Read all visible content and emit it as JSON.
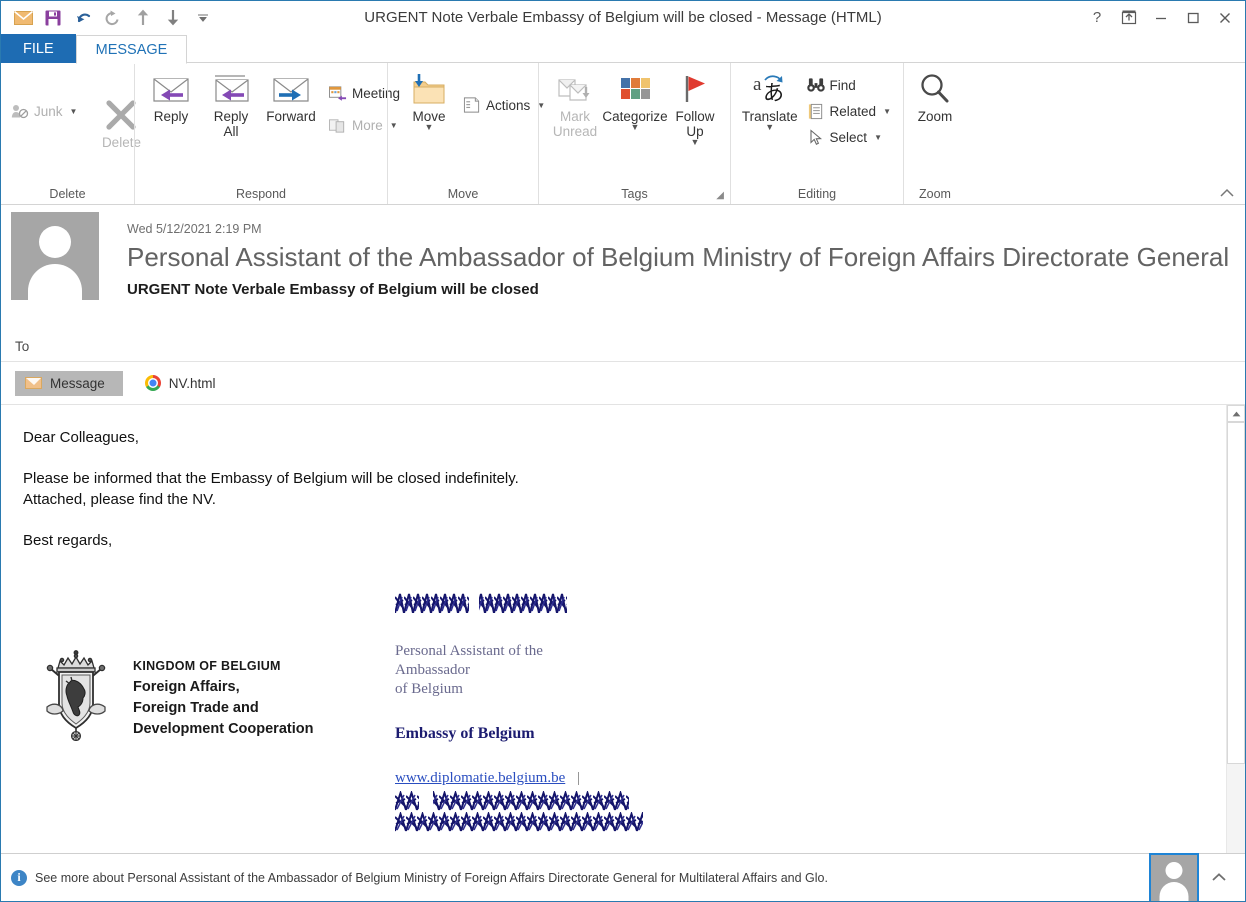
{
  "titlebar": {
    "title": "URGENT Note Verbale Embassy of Belgium will be closed - Message (HTML)",
    "qat": [
      {
        "name": "envelope-icon",
        "label": "Message"
      },
      {
        "name": "save-icon",
        "label": "Save"
      },
      {
        "name": "undo-icon",
        "label": "Undo"
      },
      {
        "name": "redo-icon",
        "label": "Redo"
      },
      {
        "name": "previous-item-icon",
        "label": "Previous Item"
      },
      {
        "name": "next-item-icon",
        "label": "Next Item"
      },
      {
        "name": "customize-qat-icon",
        "label": "Customize Quick Access Toolbar"
      }
    ],
    "help_label": "?",
    "ribbon_display_label": "Ribbon Display Options",
    "minimize_label": "—",
    "maximize_label": "☐",
    "close_label": "✕"
  },
  "tabs": [
    {
      "label": "FILE",
      "active": false
    },
    {
      "label": "MESSAGE",
      "active": true
    }
  ],
  "ribbon": {
    "collapse_label": "^",
    "groups": [
      {
        "label": "Delete",
        "items": [
          {
            "label": "Junk",
            "icon": "junk-icon",
            "disabled": true,
            "caret": true
          },
          {
            "label": "Delete",
            "icon": "delete-x-icon",
            "disabled": true
          }
        ]
      },
      {
        "label": "Respond",
        "items": [
          {
            "label": "Reply",
            "icon": "reply-icon"
          },
          {
            "label": "Reply All",
            "icon": "reply-all-icon"
          },
          {
            "label": "Forward",
            "icon": "forward-icon"
          },
          {
            "label": "Meeting",
            "icon": "meeting-icon"
          },
          {
            "label": "More",
            "icon": "more-icon",
            "disabled": true,
            "caret": true
          }
        ]
      },
      {
        "label": "Move",
        "items": [
          {
            "label": "Move",
            "icon": "move-folder-icon",
            "caret": true
          },
          {
            "label": "Actions",
            "icon": "actions-icon",
            "caret": true
          }
        ]
      },
      {
        "label": "Tags",
        "dialog_launcher": true,
        "items": [
          {
            "label": "Mark Unread",
            "icon": "mark-unread-icon",
            "disabled": true
          },
          {
            "label": "Categorize",
            "icon": "categorize-icon",
            "caret": true
          },
          {
            "label": "Follow Up",
            "icon": "follow-up-flag-icon",
            "caret": true
          }
        ]
      },
      {
        "label": "Editing",
        "items": [
          {
            "label": "Translate",
            "icon": "translate-icon",
            "caret": true
          },
          {
            "label": "Find",
            "icon": "find-binoculars-icon"
          },
          {
            "label": "Related",
            "icon": "related-document-icon",
            "caret": true
          },
          {
            "label": "Select",
            "icon": "select-cursor-icon",
            "caret": true
          }
        ]
      },
      {
        "label": "Zoom",
        "items": [
          {
            "label": "Zoom",
            "icon": "zoom-magnifier-icon"
          }
        ]
      }
    ]
  },
  "message": {
    "date": "Wed 5/12/2021 2:19 PM",
    "from": "Personal Assistant of the Ambassador of Belgium Ministry of Foreign Affairs Directorate General",
    "subject": "URGENT Note Verbale Embassy of Belgium will be closed",
    "to_label": "To",
    "to_value": "",
    "attachments": [
      {
        "label": "Message",
        "icon": "envelope-icon",
        "selected": true
      },
      {
        "label": "NV.html",
        "icon": "chrome-icon",
        "selected": false
      }
    ]
  },
  "body": {
    "greeting": "Dear Colleagues,",
    "paragraph_line1": "Please be informed that the Embassy of Belgium will be closed indefinitely.",
    "paragraph_line2": "Attached, please find the NV.",
    "closing": "Best regards,",
    "signature": {
      "name_redacted": true,
      "role_line1": "Personal Assistant of the",
      "role_line2": "Ambassador",
      "role_line3": "of Belgium",
      "organization": "Embassy of Belgium",
      "website": "www.diplomatie.belgium.be",
      "separator": "|",
      "contact_redacted": true,
      "logo": {
        "alt": "belgium-coat-of-arms",
        "line1": "KINGDOM OF BELGIUM",
        "line2": "Foreign Affairs,",
        "line3": "Foreign Trade and",
        "line4": "Development Cooperation"
      }
    }
  },
  "scrollbar": {
    "up_label": "▲",
    "down_label": "▼",
    "thumb_percent": 78
  },
  "statusbar": {
    "info_label": "i",
    "text": "See more about Personal Assistant of the Ambassador of Belgium Ministry of Foreign Affairs Directorate General for Multilateral Affairs and Glo.",
    "chevron_label": "^"
  },
  "colors": {
    "accent_blue": "#1e6cb3",
    "tab_active_text": "#2072b6",
    "window_border": "#2a7ab0",
    "link": "#2a4ec0",
    "sig_org": "#1c1c70",
    "sig_role": "#6a6a8e"
  }
}
